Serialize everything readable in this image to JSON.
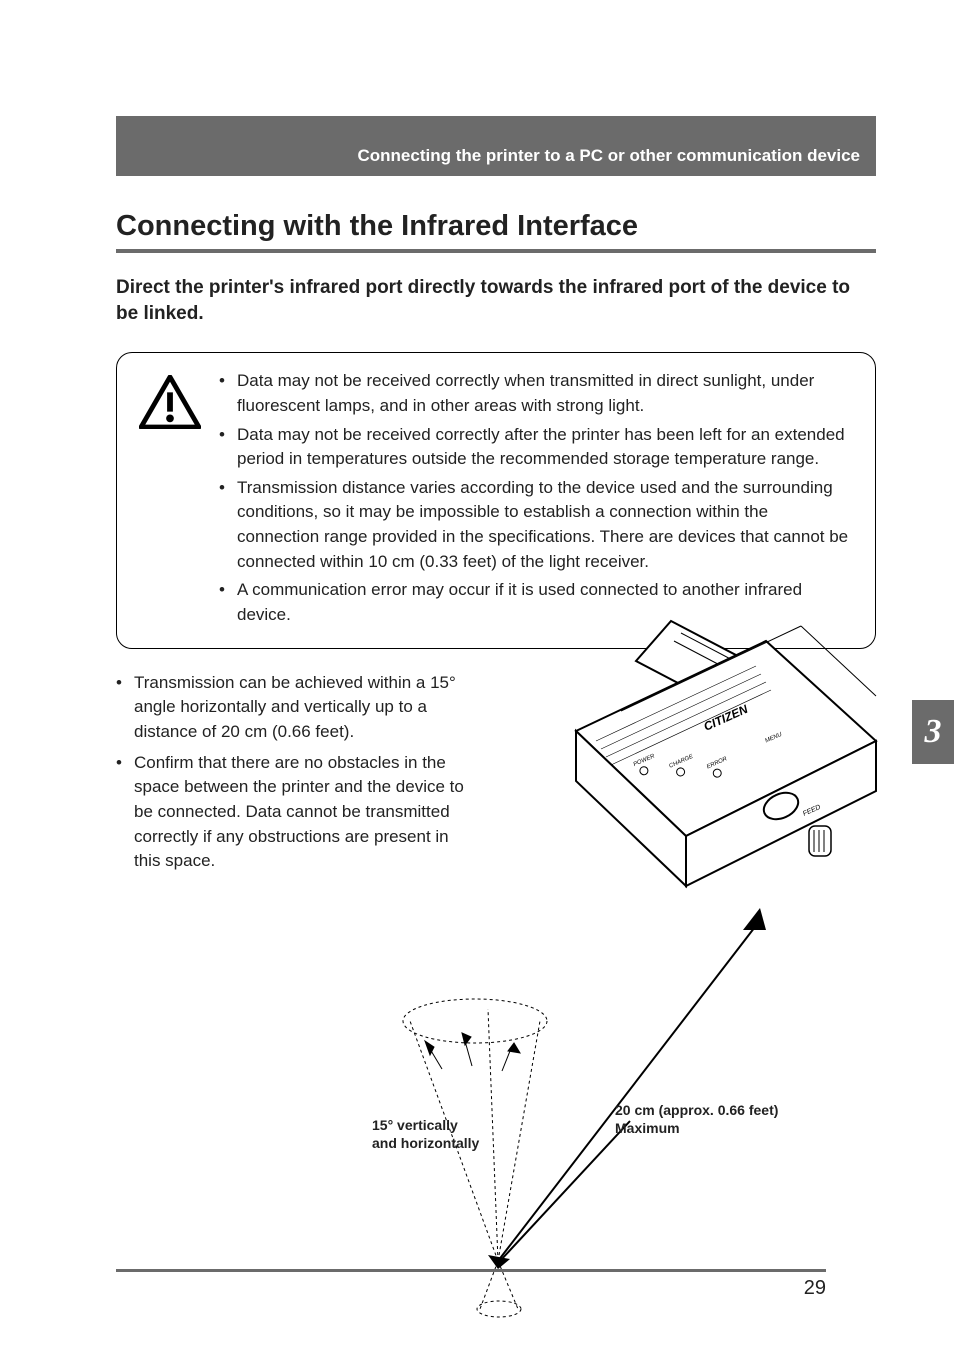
{
  "header": {
    "breadcrumb": "Connecting the printer to a PC or other communication device"
  },
  "title": "Connecting with the Infrared Interface",
  "subtitle": "Direct the printer's infrared port directly towards the infrared port of the device to be linked.",
  "warnings": {
    "items": [
      "Data may not be received correctly when transmitted in direct sunlight, under fluorescent lamps, and in other areas with strong light.",
      "Data may not be received correctly after the printer has been left for an extended period in temperatures outside the recommended storage temperature range.",
      "Transmission distance varies according to the device used and the surrounding conditions, so it may be impossible to establish a connection within the connection range provided in the specifications. There are devices that cannot be connected within 10 cm (0.33 feet) of the light receiver.",
      "A communication error may occur if it is used connected to another infrared device."
    ]
  },
  "body": {
    "items": [
      "Transmission can be achieved within a 15° angle horizontally and vertically up to a distance of 20 cm (0.66 feet).",
      "Confirm that there are no obstacles in the space between the printer and the device to be connected. Data cannot be transmitted correctly if any obstructions are present in this space."
    ]
  },
  "figure": {
    "angle_label_line1": "15° vertically",
    "angle_label_line2": "and horizontally",
    "distance_label_line1": "20 cm (approx. 0.66 feet)",
    "distance_label_line2": "Maximum",
    "printer_labels": {
      "brand": "CITIZEN",
      "power": "POWER",
      "charge": "CHARGE",
      "error": "ERROR",
      "menu": "MENU",
      "feed": "FEED"
    }
  },
  "side_tab": "3",
  "page_number": "29"
}
